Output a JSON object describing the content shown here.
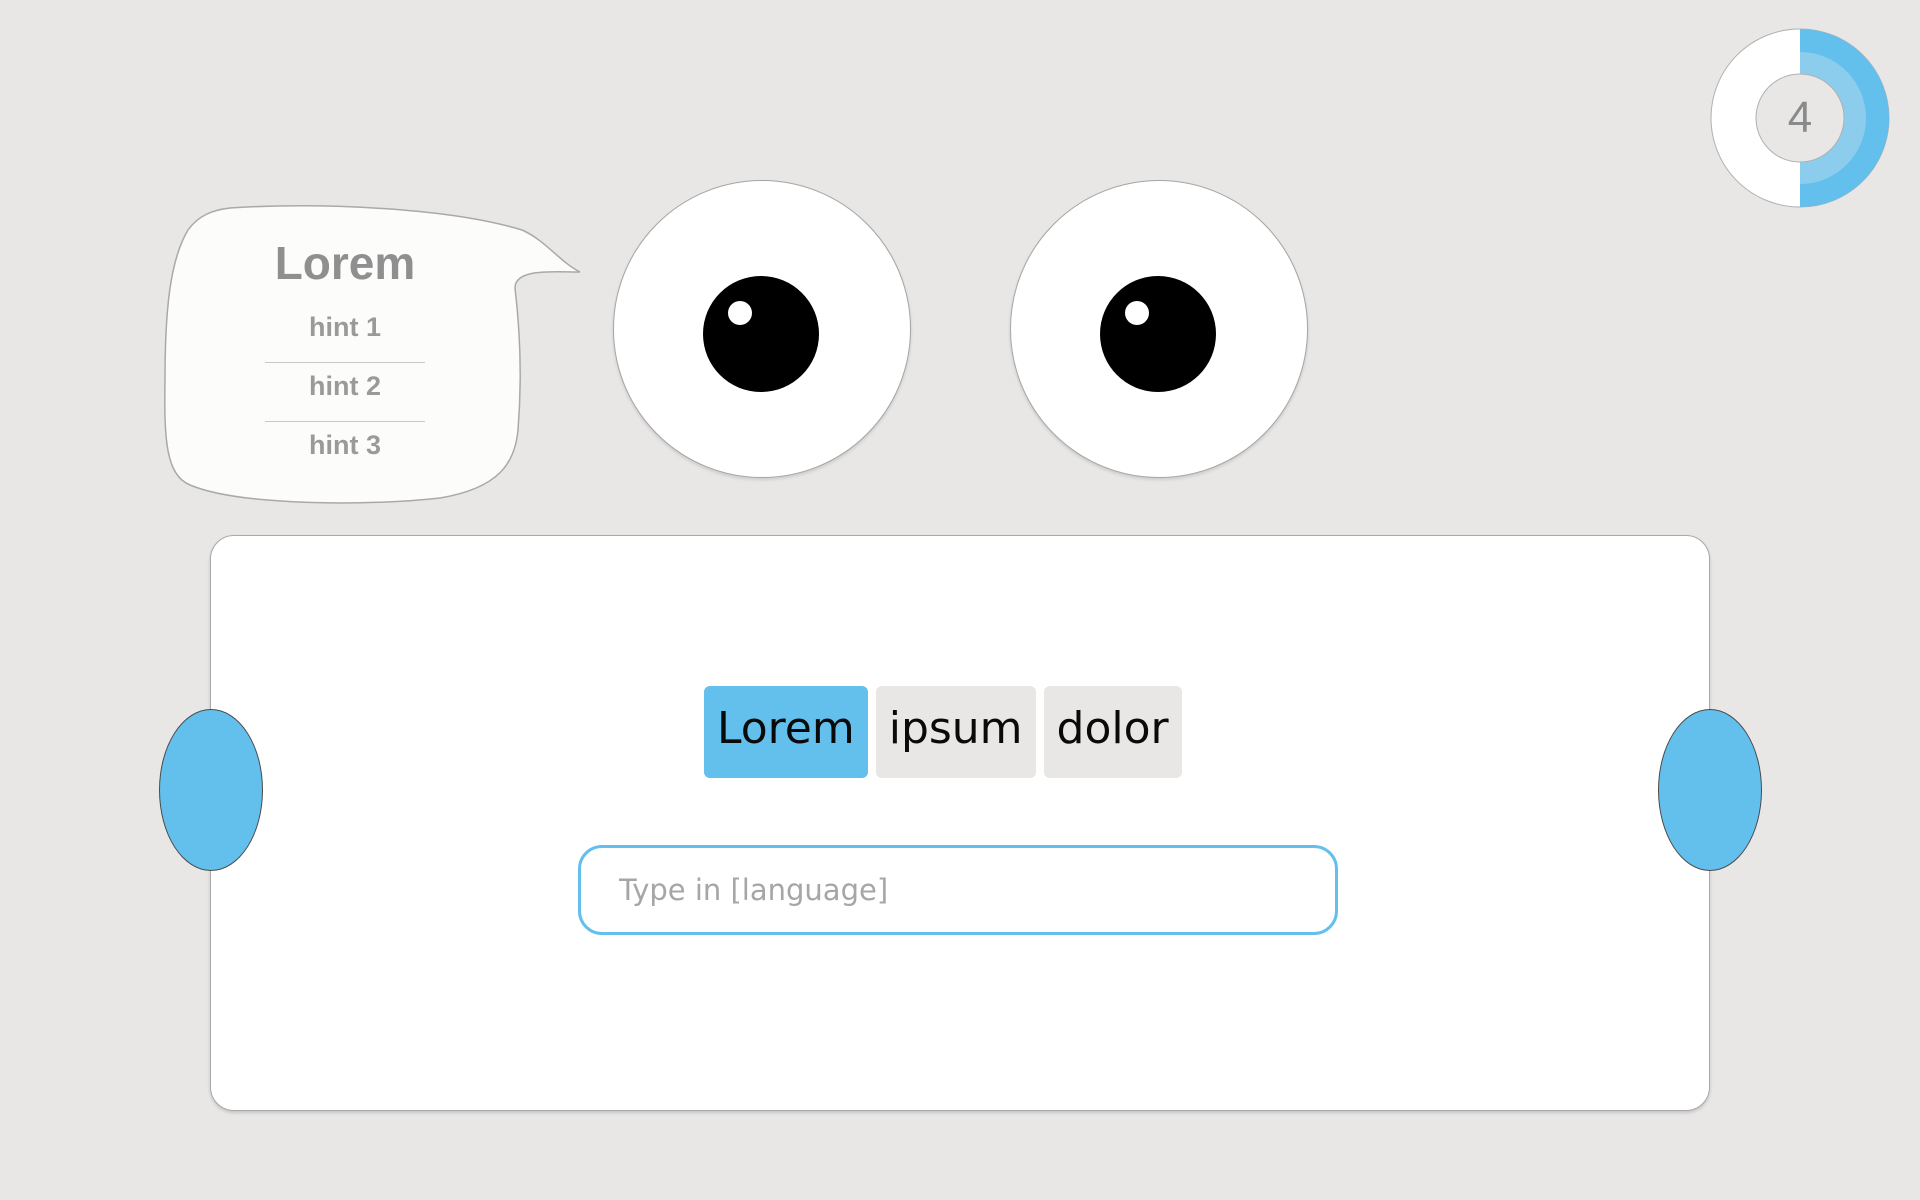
{
  "hint_bubble": {
    "word": "Lorem",
    "hints": [
      "hint 1",
      "hint 2",
      "hint 3"
    ]
  },
  "timer": {
    "value": "4",
    "progress_fraction": 0.5
  },
  "word_bank": [
    {
      "text": "Lorem",
      "selected": true
    },
    {
      "text": "ipsum",
      "selected": false
    },
    {
      "text": "dolor",
      "selected": false
    }
  ],
  "answer": {
    "placeholder": "Type in [language]",
    "value": ""
  },
  "colors": {
    "accent": "#63bfec",
    "background": "#e8e7e6",
    "card": "#ffffff",
    "muted_text": "#8f8f8f"
  }
}
